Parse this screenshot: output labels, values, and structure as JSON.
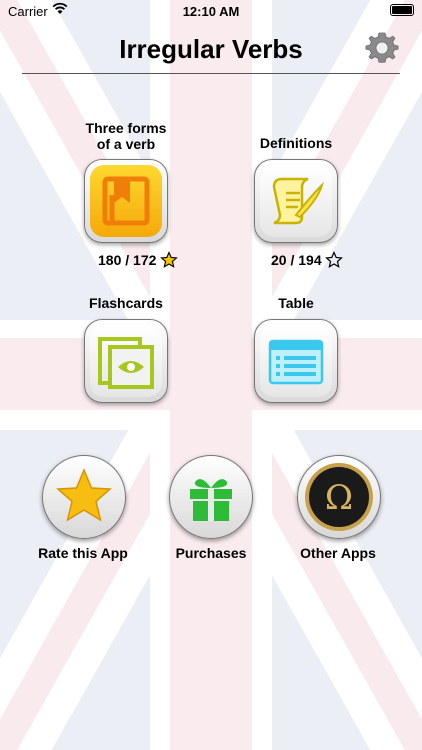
{
  "status_bar": {
    "carrier": "Carrier",
    "time": "12:10 AM"
  },
  "header": {
    "title": "Irregular Verbs"
  },
  "modes": {
    "three_forms": {
      "label_line1": "Three forms",
      "label_line2": "of a verb",
      "count": "180 / 172",
      "icon": "book-icon"
    },
    "definitions": {
      "label": "Definitions",
      "count": "20 / 194",
      "icon": "scroll-quill-icon"
    },
    "flashcards": {
      "label": "Flashcards",
      "icon": "flashcards-eye-icon"
    },
    "table": {
      "label": "Table",
      "icon": "table-list-icon"
    }
  },
  "bottom": {
    "rate": {
      "label": "Rate this App",
      "icon": "star-icon"
    },
    "purchases": {
      "label": "Purchases",
      "icon": "gift-icon"
    },
    "other_apps": {
      "label": "Other Apps",
      "icon": "omega-icon"
    }
  },
  "colors": {
    "flag_red": "#f3d3d8",
    "flag_blue": "#d8deea",
    "gold": "#f5c400",
    "orange": "#f39a0f"
  }
}
